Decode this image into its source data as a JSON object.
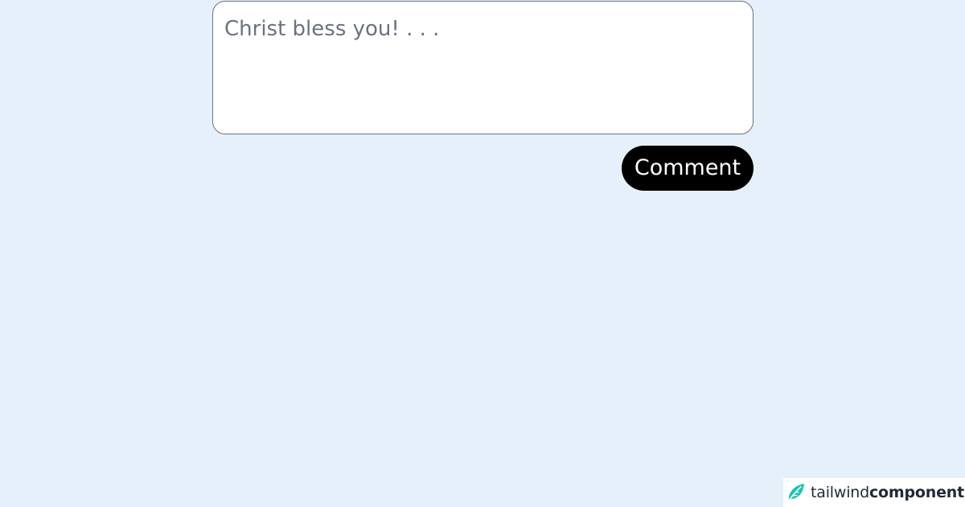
{
  "comment_form": {
    "textarea": {
      "placeholder": "Christ bless you! . . .",
      "value": ""
    },
    "submit_label": "Comment"
  },
  "watermark": {
    "logo_icon": "leaf-icon",
    "brand_light": "tailwind",
    "brand_bold": "components",
    "accent_color": "#17c3b2"
  },
  "colors": {
    "background": "#e6f0fb",
    "textarea_border": "#6b7280",
    "button_bg": "#000000",
    "button_text": "#ffffff",
    "placeholder": "#6b7280"
  }
}
